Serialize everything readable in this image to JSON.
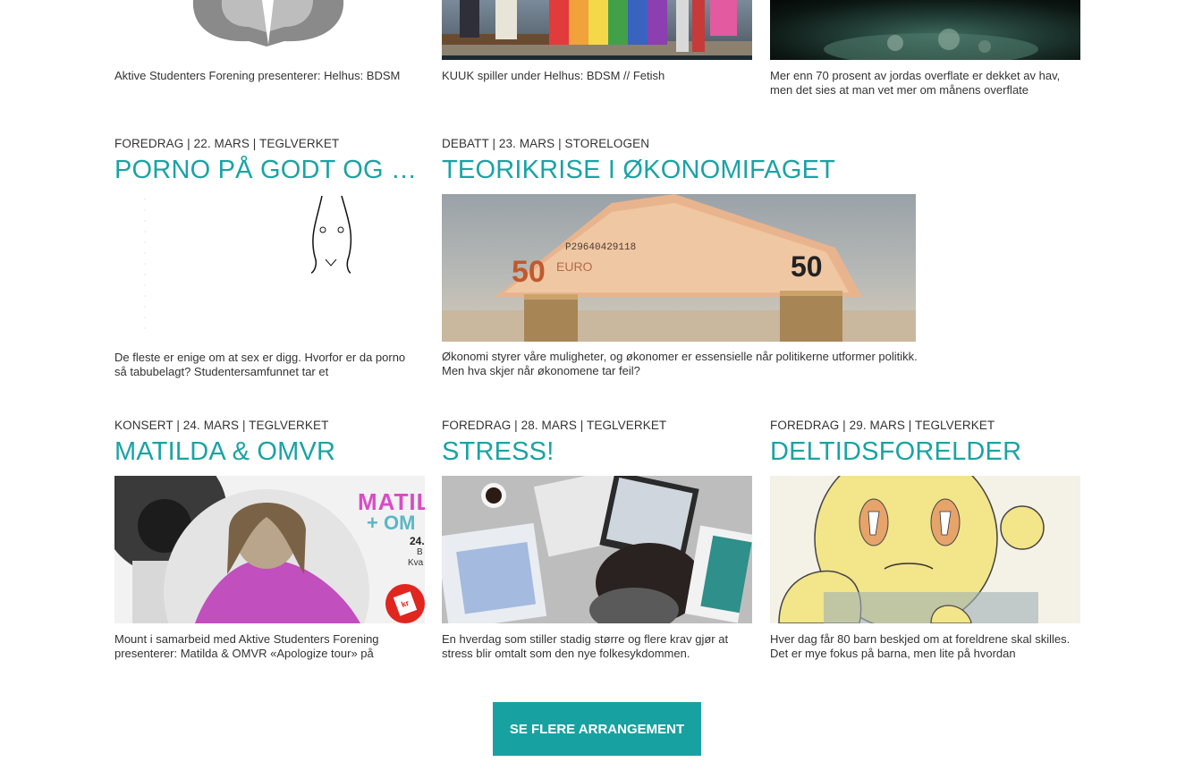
{
  "top_row": [
    {
      "desc": "Aktive Studenters Forening presenterer: Helhus: BDSM"
    },
    {
      "desc": "KUUK spiller under Helhus: BDSM // Fetish"
    },
    {
      "desc": "Mer enn 70 prosent av jordas overflate er dekket av hav, men det sies at man vet mer om månens overflate"
    }
  ],
  "events": [
    {
      "meta": "FOREDRAG | 22. MARS | TEGLVERKET",
      "title": "PORNO PÅ GODT OG VO...",
      "desc": "De fleste er enige om at sex er digg. Hvorfor er da porno så tabubelagt? Studentersamfunnet tar et"
    },
    {
      "meta": "DEBATT | 23. MARS | STORELOGEN",
      "title": "TEORIKRISE I ØKONOMIFAGET",
      "desc": "Økonomi styrer våre muligheter, og økonomer er essensielle når politikerne utformer politikk. Men hva skjer når økonomene tar feil?",
      "banknote_text": "P29640429118",
      "banknote_value_left": "50",
      "banknote_currency": "EURO",
      "banknote_value_right": "50"
    },
    {
      "meta": "KONSERT | 24. MARS | TEGLVERKET",
      "title": "MATILDA & OMVR",
      "desc": "Mount i samarbeid med Aktive Studenters Forening presenterer: Matilda & OMVR «Apologize tour» på",
      "poster_line1": "MATIL",
      "poster_line2": "+ OM",
      "poster_date": "24.",
      "poster_b": "B",
      "poster_kva": "Kva",
      "badge": "kr"
    },
    {
      "meta": "FOREDRAG | 28. MARS | TEGLVERKET",
      "title": "STRESS!",
      "desc": "En hverdag som stiller stadig større og flere krav gjør at stress blir omtalt som den nye folkesykdommen."
    },
    {
      "meta": "FOREDRAG | 29. MARS | TEGLVERKET",
      "title": "DELTIDSFORELDER",
      "desc": "Hver dag får 80 barn beskjed om at foreldrene skal skilles. Det er mye fokus på barna, men lite på hvordan"
    }
  ],
  "more_button": "SE FLERE ARRANGEMENT"
}
